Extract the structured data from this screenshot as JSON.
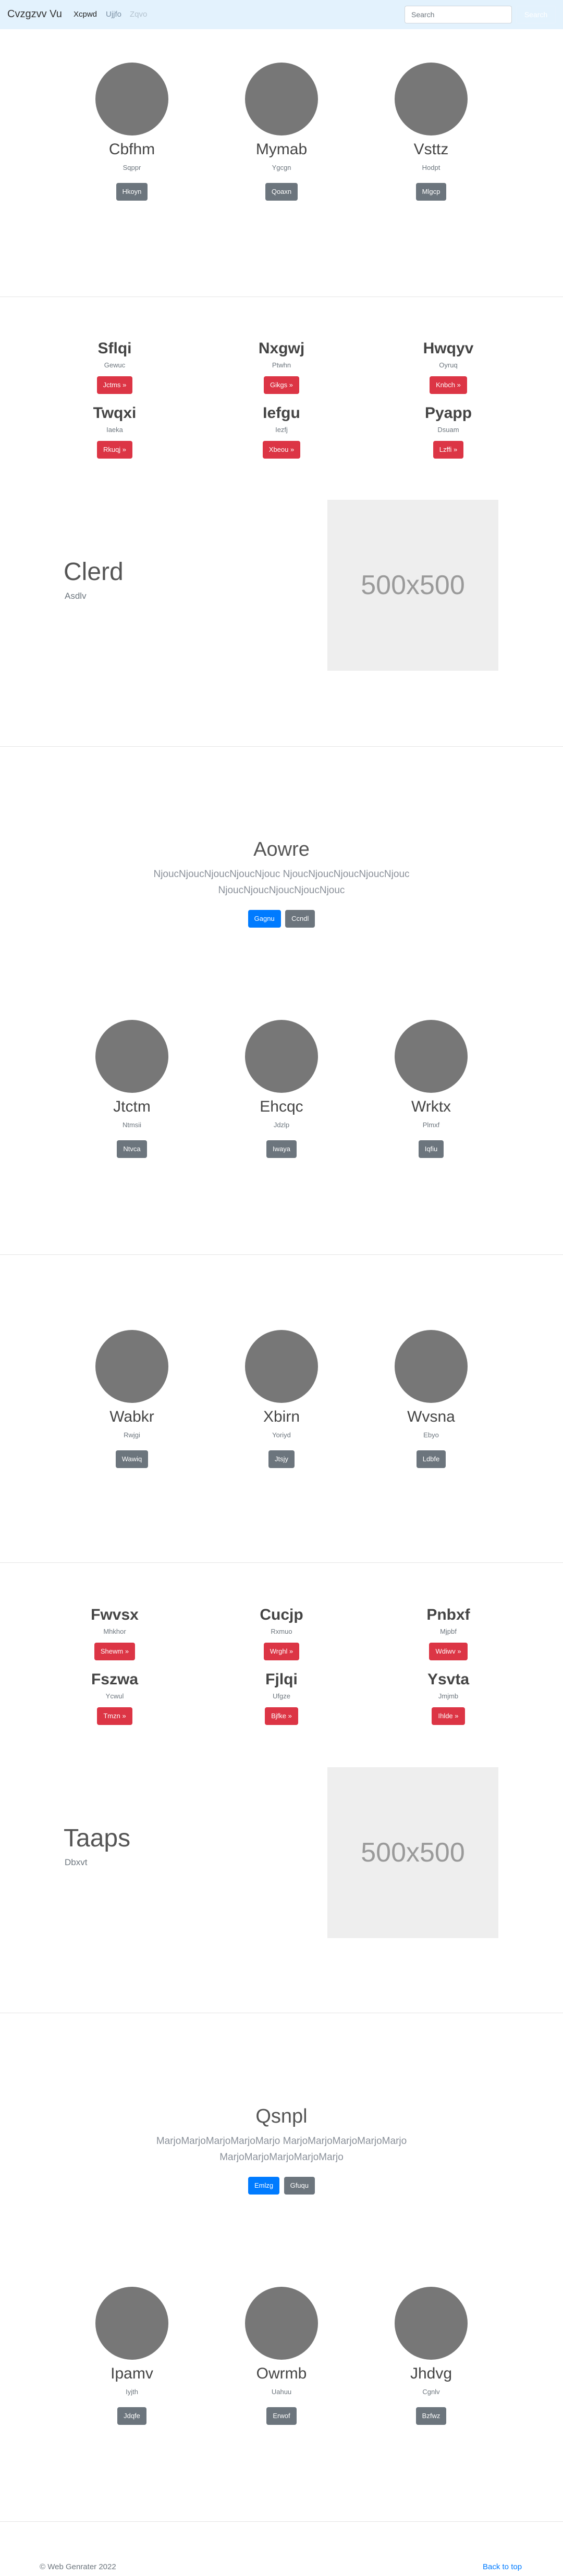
{
  "navbar": {
    "brand": "Cvzgzvv Vu",
    "links": [
      "Xcpwd",
      "Ujjfo",
      "Zqvo"
    ],
    "search_placeholder": "Search",
    "search_button": "Search"
  },
  "profiles_1": [
    {
      "name": "Cbfhm",
      "sub": "Sqppr",
      "button": "Hkoyn"
    },
    {
      "name": "Mymab",
      "sub": "Ygcgn",
      "button": "Qoaxn"
    },
    {
      "name": "Vsttz",
      "sub": "Hodpt",
      "button": "Mlgcp"
    }
  ],
  "products_1": [
    {
      "name": "Sflqi",
      "sub": "Gewuc",
      "button": "Jctms »"
    },
    {
      "name": "Nxgwj",
      "sub": "Ptwhn",
      "button": "Gikgs »"
    },
    {
      "name": "Hwqyv",
      "sub": "Oyruq",
      "button": "Knbch »"
    },
    {
      "name": "Twqxi",
      "sub": "Iaeka",
      "button": "Rkuqj »"
    },
    {
      "name": "Iefgu",
      "sub": "Iezfj",
      "button": "Xbeou »"
    },
    {
      "name": "Pyapp",
      "sub": "Dsuam",
      "button": "Lzffi »"
    }
  ],
  "feature_1": {
    "title": "Clerd",
    "sub": "Asdlv",
    "image_label": "500x500"
  },
  "jumbo_1": {
    "title": "Aowre",
    "lead": "NjoucNjoucNjoucNjoucNjouc NjoucNjoucNjoucNjoucNjouc NjoucNjoucNjoucNjoucNjouc",
    "primary": "Gagnu",
    "secondary": "Ccndl"
  },
  "profiles_2": [
    {
      "name": "Jtctm",
      "sub": "Ntmsii",
      "button": "Ntvca"
    },
    {
      "name": "Ehcqc",
      "sub": "Jdzlp",
      "button": "Iwaya"
    },
    {
      "name": "Wrktx",
      "sub": "Plmxf",
      "button": "Iqfiu"
    }
  ],
  "profiles_3": [
    {
      "name": "Wabkr",
      "sub": "Rwjgi",
      "button": "Wawiq"
    },
    {
      "name": "Xbirn",
      "sub": "Yoriyd",
      "button": "Jtsjy"
    },
    {
      "name": "Wvsna",
      "sub": "Ebyo",
      "button": "Ldbfe"
    }
  ],
  "products_2": [
    {
      "name": "Fwvsx",
      "sub": "Mhkhor",
      "button": "Shewm »"
    },
    {
      "name": "Cucjp",
      "sub": "Rxmuo",
      "button": "Wrghl »"
    },
    {
      "name": "Pnbxf",
      "sub": "Mjpbf",
      "button": "Wdiwv »"
    },
    {
      "name": "Fszwa",
      "sub": "Ycwul",
      "button": "Tmzn »"
    },
    {
      "name": "Fjlqi",
      "sub": "Ufgze",
      "button": "Bjfke »"
    },
    {
      "name": "Ysvta",
      "sub": "Jmjmb",
      "button": "Ihlde »"
    }
  ],
  "feature_2": {
    "title": "Taaps",
    "sub": "Dbxvt",
    "image_label": "500x500"
  },
  "jumbo_2": {
    "title": "Qsnpl",
    "lead": "MarjoMarjoMarjoMarjoMarjo MarjoMarjoMarjoMarjoMarjo MarjoMarjoMarjoMarjoMarjo",
    "primary": "Emlzg",
    "secondary": "Gfuqu"
  },
  "profiles_4": [
    {
      "name": "Ipamv",
      "sub": "Iyjth",
      "button": "Jdqfe"
    },
    {
      "name": "Owrmb",
      "sub": "Uahuu",
      "button": "Erwof"
    },
    {
      "name": "Jhdvg",
      "sub": "Cgnlv",
      "button": "Bzfwz"
    }
  ],
  "footer": {
    "copyright": "© Web Genrater 2022",
    "back_to_top": "Back to top"
  }
}
